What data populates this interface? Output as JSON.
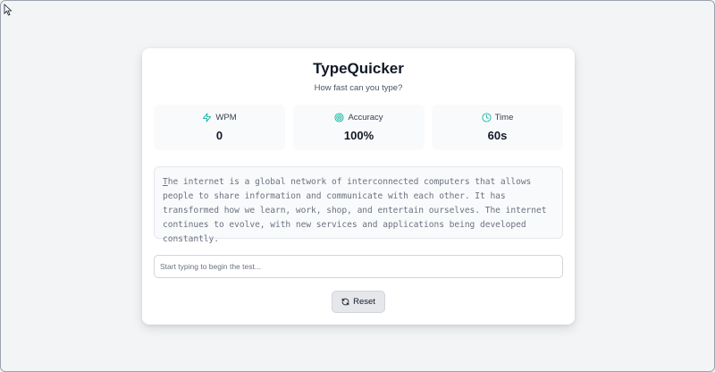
{
  "app": {
    "title": "TypeQuicker",
    "subtitle": "How fast can you type?"
  },
  "stats": [
    {
      "label": "WPM",
      "value": "0",
      "icon": "lightning-icon"
    },
    {
      "label": "Accuracy",
      "value": "100%",
      "icon": "target-icon"
    },
    {
      "label": "Time",
      "value": "60s",
      "icon": "clock-icon"
    }
  ],
  "passage": {
    "first_char": "T",
    "rest": "he internet is a global network of interconnected computers that allows people to share information and communicate with each other. It has transformed how we learn, work, shop, and entertain ourselves. The internet continues to evolve, with new services and applications being developed constantly."
  },
  "input": {
    "placeholder": "Start typing to begin the test...",
    "value": ""
  },
  "reset_button": {
    "label": "Reset",
    "icon": "refresh-icon"
  },
  "colors": {
    "accent": "#14b8a6",
    "background": "#f3f4f6",
    "card": "#ffffff",
    "stat_bg": "#f9fafb"
  }
}
